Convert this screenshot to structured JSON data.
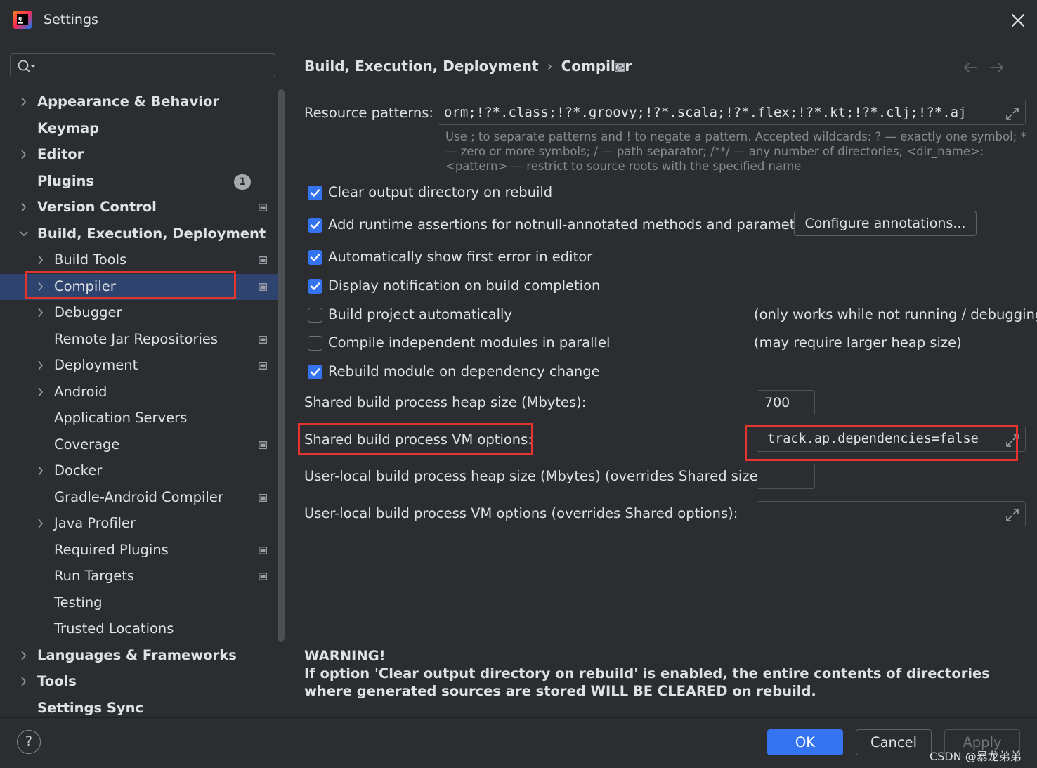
{
  "window": {
    "title": "Settings"
  },
  "sidebar": {
    "search": {
      "value": "",
      "placeholder": ""
    },
    "items": [
      {
        "label": "Appearance & Behavior",
        "level": 0,
        "expandable": true,
        "expanded": false
      },
      {
        "label": "Keymap",
        "level": 0,
        "expandable": false
      },
      {
        "label": "Editor",
        "level": 0,
        "expandable": true,
        "expanded": false
      },
      {
        "label": "Plugins",
        "level": 0,
        "expandable": false,
        "badge": "1"
      },
      {
        "label": "Version Control",
        "level": 0,
        "expandable": true,
        "expanded": false,
        "project_icon": true
      },
      {
        "label": "Build, Execution, Deployment",
        "level": 0,
        "expandable": true,
        "expanded": true
      },
      {
        "label": "Build Tools",
        "level": 1,
        "expandable": true,
        "expanded": false,
        "project_icon": true
      },
      {
        "label": "Compiler",
        "level": 1,
        "expandable": true,
        "expanded": false,
        "project_icon": true,
        "selected": true
      },
      {
        "label": "Debugger",
        "level": 1,
        "expandable": true,
        "expanded": false
      },
      {
        "label": "Remote Jar Repositories",
        "level": 1,
        "expandable": false,
        "project_icon": true
      },
      {
        "label": "Deployment",
        "level": 1,
        "expandable": true,
        "expanded": false,
        "project_icon": true
      },
      {
        "label": "Android",
        "level": 1,
        "expandable": true,
        "expanded": false
      },
      {
        "label": "Application Servers",
        "level": 1,
        "expandable": false
      },
      {
        "label": "Coverage",
        "level": 1,
        "expandable": false,
        "project_icon": true
      },
      {
        "label": "Docker",
        "level": 1,
        "expandable": true,
        "expanded": false
      },
      {
        "label": "Gradle-Android Compiler",
        "level": 1,
        "expandable": false,
        "project_icon": true
      },
      {
        "label": "Java Profiler",
        "level": 1,
        "expandable": true,
        "expanded": false
      },
      {
        "label": "Required Plugins",
        "level": 1,
        "expandable": false,
        "project_icon": true
      },
      {
        "label": "Run Targets",
        "level": 1,
        "expandable": false,
        "project_icon": true
      },
      {
        "label": "Testing",
        "level": 1,
        "expandable": false
      },
      {
        "label": "Trusted Locations",
        "level": 1,
        "expandable": false
      },
      {
        "label": "Languages & Frameworks",
        "level": 0,
        "expandable": true,
        "expanded": false
      },
      {
        "label": "Tools",
        "level": 0,
        "expandable": true,
        "expanded": false
      },
      {
        "label": "Settings Sync",
        "level": 0,
        "expandable": false
      }
    ]
  },
  "content": {
    "breadcrumb": [
      "Build, Execution, Deployment",
      "Compiler"
    ],
    "breadcrumb_separator": "›",
    "resource_patterns": {
      "label": "Resource patterns:",
      "value": "orm;!?*.class;!?*.groovy;!?*.scala;!?*.flex;!?*.kt;!?*.clj;!?*.aj",
      "hint": "Use ; to separate patterns and ! to negate a pattern. Accepted wildcards: ? — exactly one symbol; * — zero or more symbols; / — path separator; /**/ — any number of directories; <dir_name>:<pattern> — restrict to source roots with the specified name"
    },
    "checkboxes": [
      {
        "label": "Clear output directory on rebuild",
        "checked": true
      },
      {
        "label": "Add runtime assertions for notnull-annotated methods and parameters",
        "checked": true
      },
      {
        "label": "Automatically show first error in editor",
        "checked": true
      },
      {
        "label": "Display notification on build completion",
        "checked": true
      },
      {
        "label": "Build project automatically",
        "checked": false,
        "note": "(only works while not running / debugging)"
      },
      {
        "label": "Compile independent modules in parallel",
        "checked": false,
        "note": "(may require larger heap size)"
      },
      {
        "label": "Rebuild module on dependency change",
        "checked": true
      }
    ],
    "configure_annotations_label": "Configure annotations...",
    "shared_heap": {
      "label": "Shared build process heap size (Mbytes):",
      "value": "700"
    },
    "shared_vm": {
      "label": "Shared build process VM options:",
      "value": "track.ap.dependencies=false"
    },
    "user_heap": {
      "label": "User-local build process heap size (Mbytes) (overrides Shared size):",
      "value": ""
    },
    "user_vm": {
      "label": "User-local build process VM options (overrides Shared options):",
      "value": ""
    },
    "warning": {
      "title": "WARNING!",
      "text": "If option 'Clear output directory on rebuild' is enabled, the entire contents of directories where generated sources are stored WILL BE CLEARED on rebuild."
    }
  },
  "footer": {
    "help_label": "?",
    "ok_label": "OK",
    "cancel_label": "Cancel",
    "apply_label": "Apply",
    "watermark": "CSDN @暴龙弟弟"
  },
  "colors": {
    "background": "#2b2d30",
    "selection": "#2e436e",
    "accent": "#3574f0",
    "annotation_red": "#e5332e",
    "text": "#dfe1e5",
    "hint_text": "#868a91"
  }
}
